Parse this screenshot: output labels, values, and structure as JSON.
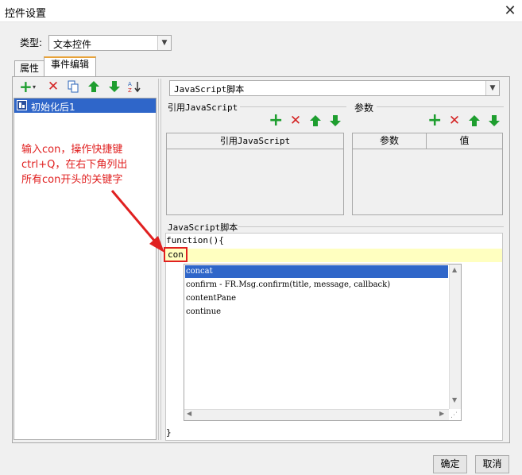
{
  "window": {
    "title": "控件设置"
  },
  "type_row": {
    "label": "类型:",
    "value": "文本控件"
  },
  "tabs": [
    {
      "label": "属性"
    },
    {
      "label": "事件编辑"
    }
  ],
  "event_list": {
    "items": [
      {
        "label": "初始化后1"
      }
    ]
  },
  "script_type": {
    "value": "JavaScript脚本"
  },
  "ref_section": {
    "title": "引用JavaScript",
    "column_header": "引用JavaScript"
  },
  "params_section": {
    "title": "参数",
    "columns": [
      "参数",
      "值"
    ]
  },
  "script_section": {
    "title": "JavaScript脚本",
    "first_line": "function(){",
    "typed": "con",
    "last_line": "}"
  },
  "autocomplete": {
    "items": [
      {
        "label": "concat",
        "selected": true
      },
      {
        "label": "confirm - FR.Msg.confirm(title, message, callback)",
        "selected": false
      },
      {
        "label": "contentPane",
        "selected": false
      },
      {
        "label": "continue",
        "selected": false
      }
    ]
  },
  "annotation": {
    "lines": [
      "输入con，操作快捷键",
      "ctrl+Q，在右下角列出",
      "所有con开头的关键字"
    ]
  },
  "footer": {
    "ok_label": "确定",
    "cancel_label": "取消"
  },
  "colors": {
    "accent_tab": "#e8a33a",
    "selection": "#2f66c9",
    "annotation": "#e02020",
    "editor_line": "#ffffc0",
    "add_icon": "#1e9e2f",
    "delete_icon": "#d42525"
  }
}
